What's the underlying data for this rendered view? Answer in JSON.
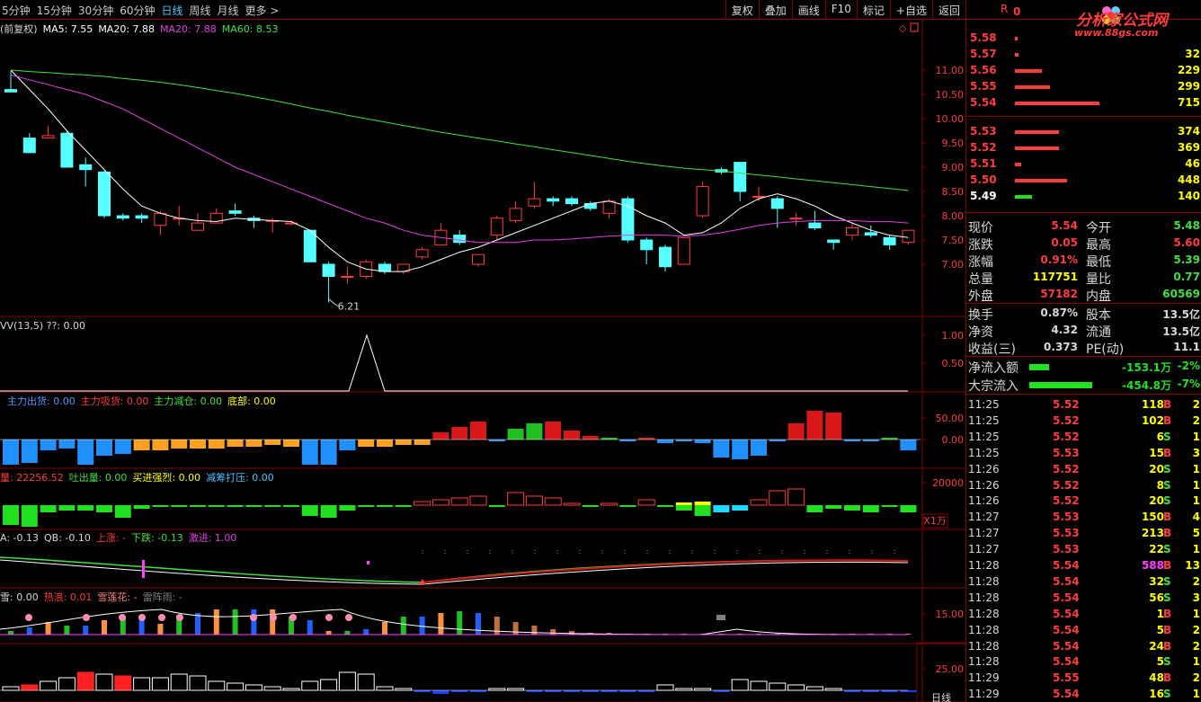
{
  "toolbar": {
    "periods": [
      "5分钟",
      "15分钟",
      "30分钟",
      "60分钟",
      "日线",
      "周线",
      "月线",
      "更多 >"
    ],
    "active_period": "日线",
    "buttons": [
      "复权",
      "叠加",
      "画线",
      "F10",
      "标记",
      "+自选",
      "返回"
    ]
  },
  "main_panel": {
    "header": [
      {
        "text": "(前复权)",
        "color": "#d8d8d8"
      },
      {
        "text": "MA5: 7.55",
        "color": "#ffffff"
      },
      {
        "text": "MA20: 7.88",
        "color": "#ffffff"
      },
      {
        "text": "MA20: 7.88",
        "color": "#e040e0"
      },
      {
        "text": "MA60: 8.53",
        "color": "#40e040"
      }
    ],
    "y_ticks": [
      "11.00",
      "10.50",
      "10.00",
      "9.50",
      "9.00",
      "8.50",
      "8.00",
      "7.50",
      "7.00"
    ],
    "low_label": "6.21"
  },
  "panel2": {
    "header": [
      {
        "text": "VV(13,5)  ??: 0.00",
        "color": "#d8d8d8"
      }
    ],
    "y_ticks": [
      "1.00",
      "0.50"
    ]
  },
  "panel3": {
    "header": [
      {
        "text": "主力出货: 0.00",
        "color": "#4c9cff"
      },
      {
        "text": "主力吸货: 0.00",
        "color": "#ff3c3c"
      },
      {
        "text": "主力减仓: 0.00",
        "color": "#40e040"
      },
      {
        "text": "底部: 0.00",
        "color": "#ffff00"
      }
    ],
    "y_ticks": [
      "50.00",
      "0.00"
    ]
  },
  "panel4": {
    "header": [
      {
        "text": "量: 22256.52",
        "color": "#ff3c3c"
      },
      {
        "text": "吐出量: 0.00",
        "color": "#40e040"
      },
      {
        "text": "买进强烈: 0.00",
        "color": "#ffff00"
      },
      {
        "text": "减筹打压: 0.00",
        "color": "#4cc4ff"
      }
    ],
    "y_ticks": [
      "20000"
    ],
    "unit": "X1万"
  },
  "panel5": {
    "header": [
      {
        "text": "A: -0.13",
        "color": "#d8d8d8"
      },
      {
        "text": "QB: -0.10",
        "color": "#d8d8d8"
      },
      {
        "text": "上涨: -",
        "color": "#ff3c3c"
      },
      {
        "text": "下跌: -0.13",
        "color": "#40e040"
      },
      {
        "text": "激进: 1.00",
        "color": "#e040e0"
      }
    ]
  },
  "panel6": {
    "header": [
      {
        "text": "雪: 0.00",
        "color": "#d8d8d8"
      },
      {
        "text": "热浪: 0.01",
        "color": "#ff3c3c"
      },
      {
        "text": "雪莲花: -",
        "color": "#ff8080"
      },
      {
        "text": "雷阵雨: -",
        "color": "#808080"
      }
    ],
    "y_ticks": [
      "15.00"
    ]
  },
  "panel7": {
    "y_ticks": [
      "25.00"
    ],
    "footer": "日线"
  },
  "side": {
    "r_label": "R",
    "zero": "0",
    "logo_text": "分析家公式网",
    "logo_url": "www.88gs.com",
    "order_book_asks": [
      {
        "price": "5.58",
        "vol": "",
        "bar": 0.02
      },
      {
        "price": "5.57",
        "vol": "32",
        "bar": 0.04
      },
      {
        "price": "5.56",
        "vol": "229",
        "bar": 0.32
      },
      {
        "price": "5.55",
        "vol": "299",
        "bar": 0.42
      },
      {
        "price": "5.54",
        "vol": "715",
        "bar": 1.0
      }
    ],
    "order_book_bids": [
      {
        "price": "5.53",
        "vol": "374",
        "bar": 0.52
      },
      {
        "price": "5.52",
        "vol": "369",
        "bar": 0.52
      },
      {
        "price": "5.51",
        "vol": "46",
        "bar": 0.07
      },
      {
        "price": "5.50",
        "vol": "448",
        "bar": 0.62
      },
      {
        "price": "5.49",
        "vol": "140",
        "bar": 0.2
      }
    ],
    "quotes": [
      {
        "l1": "现价",
        "v1": "5.54",
        "c1": "#ff3c3c",
        "l2": "今开",
        "v2": "5.48",
        "c2": "#40e040"
      },
      {
        "l1": "涨跌",
        "v1": "0.05",
        "c1": "#ff3c3c",
        "l2": "最高",
        "v2": "5.60",
        "c2": "#ff3c3c"
      },
      {
        "l1": "涨幅",
        "v1": "0.91%",
        "c1": "#ff3c3c",
        "l2": "最低",
        "v2": "5.39",
        "c2": "#40e040"
      },
      {
        "l1": "总量",
        "v1": "117751",
        "c1": "#ffff00",
        "l2": "量比",
        "v2": "0.77",
        "c2": "#40e040"
      },
      {
        "l1": "外盘",
        "v1": "57182",
        "c1": "#ff3c3c",
        "l2": "内盘",
        "v2": "60569",
        "c2": "#40e040"
      }
    ],
    "quotes2": [
      {
        "l1": "换手",
        "v1": "0.87%",
        "c1": "#d8d8d8",
        "l2": "股本",
        "v2": "13.5亿",
        "c2": "#d8d8d8"
      },
      {
        "l1": "净资",
        "v1": "4.32",
        "c1": "#d8d8d8",
        "l2": "流通",
        "v2": "13.5亿",
        "c2": "#d8d8d8"
      },
      {
        "l1": "收益(三)",
        "v1": "0.373",
        "c1": "#d8d8d8",
        "l2": "PE(动)",
        "v2": "11.1",
        "c2": "#d8d8d8"
      }
    ],
    "flows": [
      {
        "label": "净流入额",
        "amount": "-153.1万",
        "pct": "-2%",
        "bar": 0.25
      },
      {
        "label": "大宗流入",
        "amount": "-454.8万",
        "pct": "-7%",
        "bar": 0.8
      }
    ],
    "ticks": [
      {
        "t": "11:25",
        "p": "5.52",
        "v": "118",
        "bs": "B",
        "n": "2"
      },
      {
        "t": "11:25",
        "p": "5.52",
        "v": "102",
        "bs": "B",
        "n": "2"
      },
      {
        "t": "11:25",
        "p": "5.52",
        "v": "6",
        "bs": "S",
        "n": "1"
      },
      {
        "t": "11:25",
        "p": "5.53",
        "v": "15",
        "bs": "B",
        "n": "3"
      },
      {
        "t": "11:26",
        "p": "5.52",
        "v": "20",
        "bs": "S",
        "n": "1"
      },
      {
        "t": "11:26",
        "p": "5.52",
        "v": "8",
        "bs": "S",
        "n": "1"
      },
      {
        "t": "11:26",
        "p": "5.52",
        "v": "20",
        "bs": "S",
        "n": "1"
      },
      {
        "t": "11:27",
        "p": "5.53",
        "v": "150",
        "bs": "B",
        "n": "4"
      },
      {
        "t": "11:27",
        "p": "5.53",
        "v": "213",
        "bs": "B",
        "n": "5"
      },
      {
        "t": "11:27",
        "p": "5.53",
        "v": "22",
        "bs": "S",
        "n": "1"
      },
      {
        "t": "11:28",
        "p": "5.54",
        "v": "588",
        "bs": "B",
        "n": "13"
      },
      {
        "t": "11:28",
        "p": "5.54",
        "v": "32",
        "bs": "S",
        "n": "2"
      },
      {
        "t": "11:28",
        "p": "5.54",
        "v": "56",
        "bs": "S",
        "n": "3"
      },
      {
        "t": "11:28",
        "p": "5.54",
        "v": "1",
        "bs": "B",
        "n": "1"
      },
      {
        "t": "11:28",
        "p": "5.54",
        "v": "5",
        "bs": "B",
        "n": "2"
      },
      {
        "t": "11:28",
        "p": "5.54",
        "v": "24",
        "bs": "B",
        "n": "2"
      },
      {
        "t": "11:28",
        "p": "5.54",
        "v": "5",
        "bs": "S",
        "n": "1"
      },
      {
        "t": "11:29",
        "p": "5.55",
        "v": "48",
        "bs": "B",
        "n": "2"
      },
      {
        "t": "11:29",
        "p": "5.54",
        "v": "16",
        "bs": "S",
        "n": "1"
      }
    ]
  },
  "colors": {
    "up": "#ff3c3c",
    "down": "#54ffff",
    "border": "#800000",
    "buy": "#ff3c3c",
    "sell": "#40e040",
    "highlight_vol": "#ff40ff"
  }
}
